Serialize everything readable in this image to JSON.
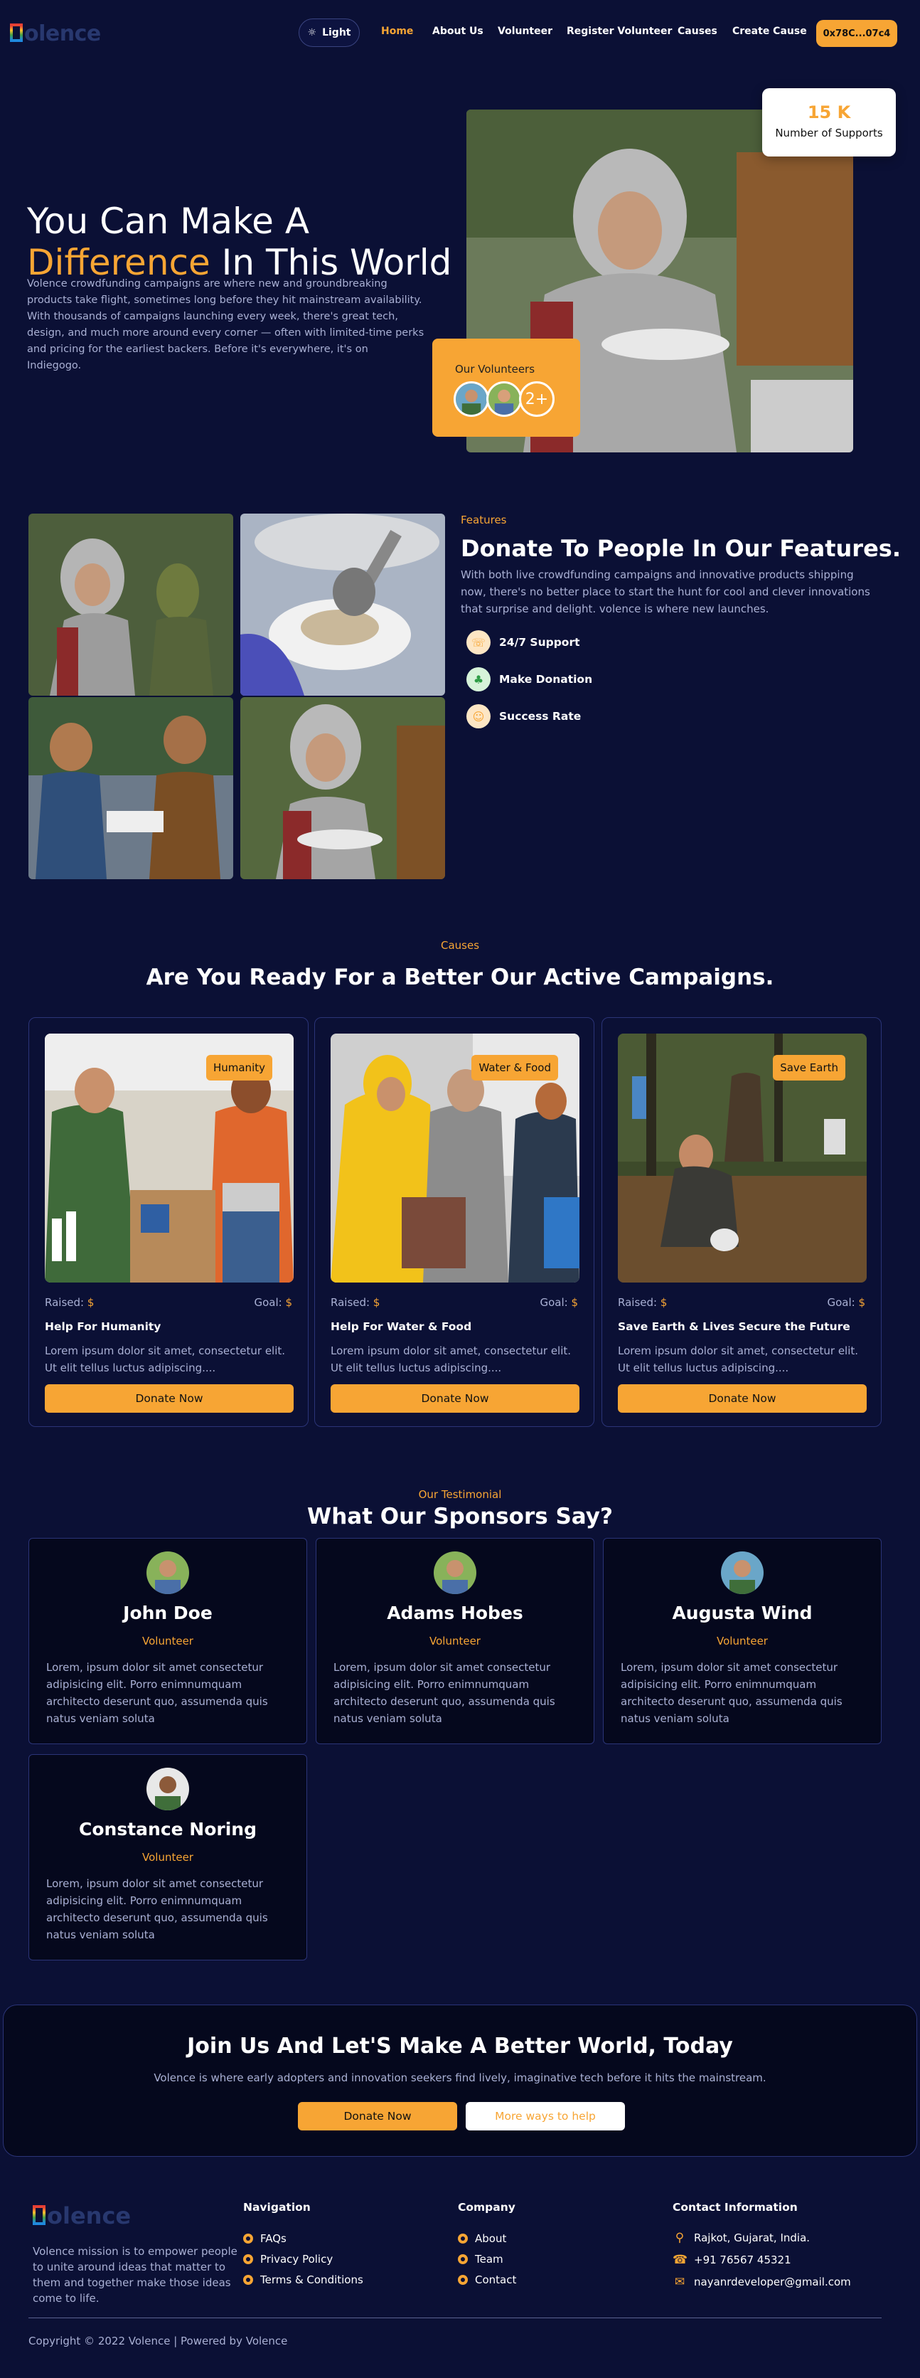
{
  "nav": {
    "logo_text": "olence",
    "theme_label": "Light",
    "links": [
      "Home",
      "About Us",
      "Volunteer",
      "Register Volunteer",
      "Causes",
      "Create Cause"
    ],
    "wallet": "0x78C...07c4"
  },
  "hero": {
    "title_line1": "You Can Make A",
    "title_highlight": "Difference",
    "title_rest": " In This World",
    "description": "Volence crowdfunding campaigns are where new and groundbreaking products take flight, sometimes long before they hit mainstream availability. With thousands of campaigns launching every week, there's great tech, design, and much more around every corner — often with limited-time perks and pricing for the earliest backers. Before it's everywhere, it's on Indiegogo.",
    "supports_count": "15 K",
    "supports_label": "Number of Supports",
    "volunteers_label": "Our Volunteers",
    "volunteers_more": "2+"
  },
  "features": {
    "tag": "Features",
    "title": "Donate To People In Our Features.",
    "description": "With both live crowdfunding campaigns and innovative products shipping now, there's no better place to start the hunt for cool and clever innovations that surprise and delight. volence is where new launches.",
    "items": [
      "24/7 Support",
      "Make Donation",
      "Success Rate"
    ]
  },
  "causes": {
    "tag": "Causes",
    "title": "Are You Ready For a Better Our Active Campaigns.",
    "raised_label": "Raised:",
    "goal_label": "Goal:",
    "currency": "$",
    "button": "Donate Now",
    "items": [
      {
        "badge": "Humanity",
        "name": "Help For Humanity",
        "text": "Lorem ipsum dolor sit amet, consectetur elit. Ut elit tellus luctus adipiscing...."
      },
      {
        "badge": "Water & Food",
        "name": "Help For Water & Food",
        "text": "Lorem ipsum dolor sit amet, consectetur elit. Ut elit tellus luctus adipiscing...."
      },
      {
        "badge": "Save Earth",
        "name": "Save Earth & Lives Secure the Future",
        "text": "Lorem ipsum dolor sit amet, consectetur elit. Ut elit tellus luctus adipiscing...."
      }
    ]
  },
  "testimonials": {
    "tag": "Our Testimonial",
    "title": "What Our Sponsors Say?",
    "items": [
      {
        "name": "John Doe",
        "role": "Volunteer",
        "quote": "Lorem, ipsum dolor sit amet consectetur adipisicing elit. Porro enimnumquam architecto deserunt quo, assumenda quis natus veniam soluta"
      },
      {
        "name": "Adams Hobes",
        "role": "Volunteer",
        "quote": "Lorem, ipsum dolor sit amet consectetur adipisicing elit. Porro enimnumquam architecto deserunt quo, assumenda quis natus veniam soluta"
      },
      {
        "name": "Augusta Wind",
        "role": "Volunteer",
        "quote": "Lorem, ipsum dolor sit amet consectetur adipisicing elit. Porro enimnumquam architecto deserunt quo, assumenda quis natus veniam soluta"
      },
      {
        "name": "Constance Noring",
        "role": "Volunteer",
        "quote": "Lorem, ipsum dolor sit amet consectetur adipisicing elit. Porro enimnumquam architecto deserunt quo, assumenda quis natus veniam soluta"
      }
    ]
  },
  "cta": {
    "title": "Join Us And Let'S Make A Better World, Today",
    "description": "Volence is where early adopters and innovation seekers find lively, imaginative tech before it hits the mainstream.",
    "primary": "Donate Now",
    "secondary": "More ways to help"
  },
  "footer": {
    "logo_text": "olence",
    "about": "Volence mission is to empower people to unite around ideas that matter to them and together make those ideas come to life.",
    "nav_title": "Navigation",
    "nav_links": [
      "FAQs",
      "Privacy Policy",
      "Terms & Conditions"
    ],
    "company_title": "Company",
    "company_links": [
      "About",
      "Team",
      "Contact"
    ],
    "contact_title": "Contact Information",
    "address": "Rajkot, Gujarat, India.",
    "phone": "+91 76567 45321",
    "email": "nayanrdeveloper@gmail.com",
    "copyright": "Copyright © 2022 Volence | Powered by Volence"
  },
  "colors": {
    "accent": "#f7a534",
    "background": "#0b1035"
  }
}
